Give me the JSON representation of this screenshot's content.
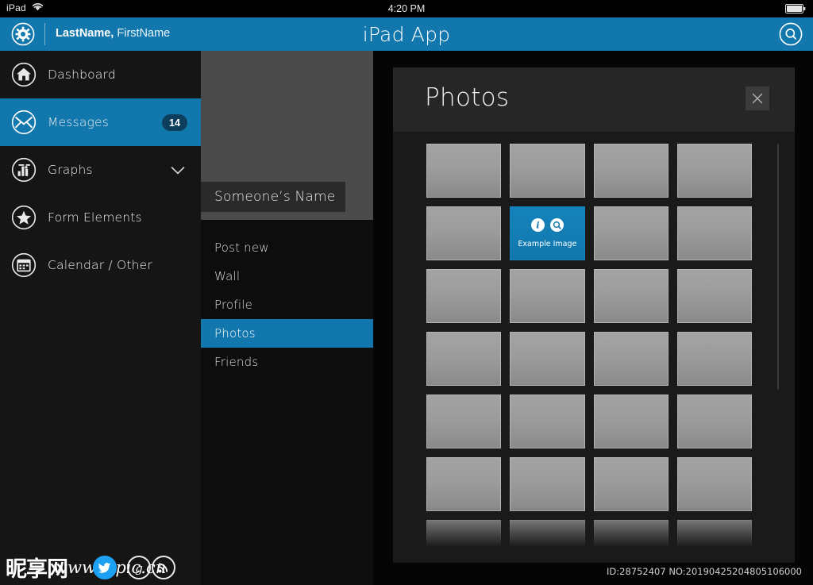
{
  "status_bar": {
    "device_label": "iPad",
    "wifi_icon": "wifi-icon",
    "time": "4:20 PM",
    "battery_icon": "battery-icon"
  },
  "header": {
    "gear_icon": "gear-icon",
    "user_last_name": "LastName,",
    "user_first_name": " FirstName",
    "title": "iPad App",
    "search_icon": "search-icon",
    "accent_color": "#1277ac"
  },
  "sidebar": {
    "background": "#151515",
    "items": [
      {
        "label": "Dashboard",
        "icon": "home-icon",
        "active": false,
        "badge": "",
        "chevron": false
      },
      {
        "label": "Messages",
        "icon": "envelope-icon",
        "active": true,
        "badge": "14",
        "chevron": false
      },
      {
        "label": "Graphs",
        "icon": "bar-chart-icon",
        "active": false,
        "badge": "",
        "chevron": true
      },
      {
        "label": "Form Elements",
        "icon": "star-icon",
        "active": false,
        "badge": "",
        "chevron": false
      },
      {
        "label": "Calendar / Other",
        "icon": "calendar-icon",
        "active": false,
        "badge": "",
        "chevron": false
      }
    ]
  },
  "watermark": {
    "chinese_text": "昵享网",
    "url_text": "www.nipic.cn",
    "social_icons": [
      "twitter-icon",
      "google-plus-icon",
      "rss-icon"
    ]
  },
  "profile_panel": {
    "avatar_placeholder": "avatar-placeholder",
    "name": "Someone’s Name",
    "menu": [
      {
        "label": "Post new",
        "active": false
      },
      {
        "label": "Wall",
        "active": false
      },
      {
        "label": "Profile",
        "active": false
      },
      {
        "label": "Photos",
        "active": true
      },
      {
        "label": "Friends",
        "active": false
      }
    ]
  },
  "photos_modal": {
    "title": "Photos",
    "close_icon": "close-icon",
    "selected_tile": {
      "caption": "Example Image",
      "info_icon": "info-icon",
      "zoom_icon": "zoom-icon",
      "highlight_color": "#1277ac"
    },
    "grid": {
      "columns": 4,
      "rows": 6,
      "tiles": [
        [
          {
            "selected": false
          },
          {
            "selected": false
          },
          {
            "selected": false
          },
          {
            "selected": false
          }
        ],
        [
          {
            "selected": false
          },
          {
            "selected": true
          },
          {
            "selected": false
          },
          {
            "selected": false
          }
        ],
        [
          {
            "selected": false
          },
          {
            "selected": false
          },
          {
            "selected": false
          },
          {
            "selected": false
          }
        ],
        [
          {
            "selected": false
          },
          {
            "selected": false
          },
          {
            "selected": false
          },
          {
            "selected": false
          }
        ],
        [
          {
            "selected": false
          },
          {
            "selected": false
          },
          {
            "selected": false
          },
          {
            "selected": false
          }
        ],
        [
          {
            "selected": false
          },
          {
            "selected": false
          },
          {
            "selected": false
          },
          {
            "selected": false
          }
        ]
      ]
    },
    "scrollbar": "vertical-scrollbar"
  },
  "footer": {
    "id_text": "ID:28752407 NO:20190425204805106000"
  }
}
